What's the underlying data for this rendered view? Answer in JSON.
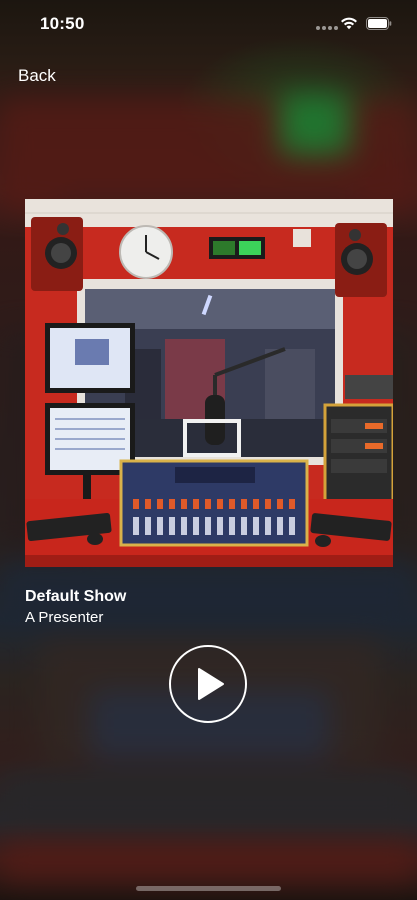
{
  "status_bar": {
    "time": "10:50",
    "wifi_icon": "wifi-icon",
    "battery_icon": "battery-icon"
  },
  "nav": {
    "back_label": "Back"
  },
  "now_playing": {
    "artwork_icon": "radio-studio-artwork",
    "show_title": "Default Show",
    "presenter": "A Presenter",
    "play_icon": "play-icon"
  },
  "colors": {
    "text": "#ffffff",
    "studio_red": "#c8281e",
    "on_air_green": "#3cd35a"
  }
}
